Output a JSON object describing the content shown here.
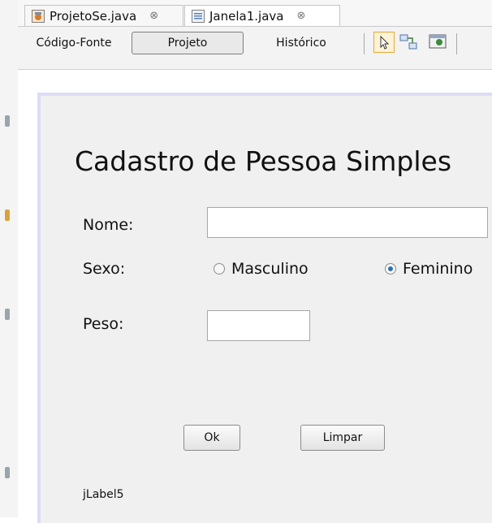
{
  "tabs": [
    {
      "label": "ProjetoSe.java",
      "close": "⊗",
      "icon": "java-form-icon"
    },
    {
      "label": "Janela1.java",
      "close": "⊗",
      "icon": "java-file-icon"
    }
  ],
  "view_toolbar": {
    "source_label": "Código-Fonte",
    "design_label": "Projeto",
    "history_label": "Histórico",
    "tools": [
      "selection-mode-icon",
      "connection-mode-icon",
      "preview-design-icon"
    ]
  },
  "form": {
    "title": "Cadastro de Pessoa Simples",
    "name_label": "Nome:",
    "name_value": "",
    "sex_label": "Sexo:",
    "radio_male": "Masculino",
    "radio_female": "Feminino",
    "selected_sex": "Feminino",
    "weight_label": "Peso:",
    "weight_value": "",
    "ok_label": "Ok",
    "clear_label": "Limpar",
    "status_label": "jLabel5"
  },
  "colors": {
    "frame_border": "#dcdcf6",
    "form_background": "#f0f0f0",
    "radio_selected": "#2f6fb5"
  }
}
